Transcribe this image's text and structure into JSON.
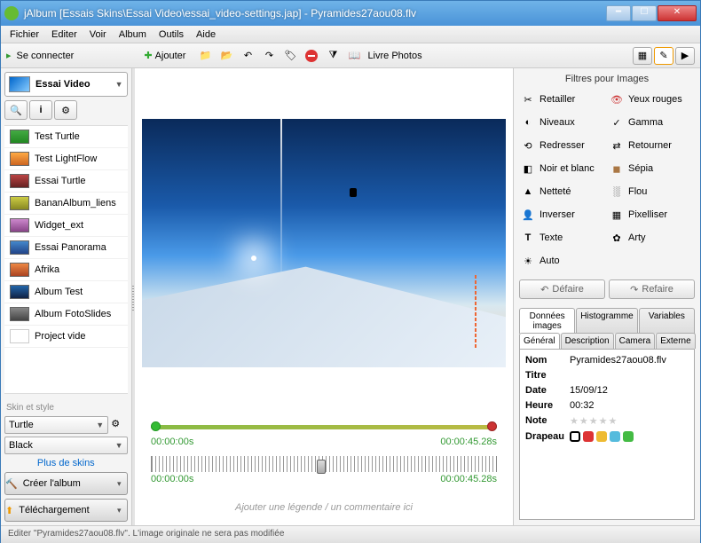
{
  "window": {
    "title": "jAlbum [Essais Skins\\Essai Video\\essai_video-settings.jap] - Pyramides27aou08.flv"
  },
  "menu": {
    "items": [
      "Fichier",
      "Editer",
      "Voir",
      "Album",
      "Outils",
      "Aide"
    ]
  },
  "toolbar": {
    "connect": "Se connecter",
    "add": "Ajouter",
    "livre": "Livre Photos"
  },
  "sidebar": {
    "current": "Essai Video",
    "albums": [
      "Test Turtle",
      "Test LightFlow",
      "Essai Turtle",
      "BananAlbum_liens",
      "Widget_ext",
      "Essai Panorama",
      "Afrika",
      "Album Test",
      "Album FotoSlides",
      "Project vide"
    ],
    "skin_label": "Skin et style",
    "skin": "Turtle",
    "style": "Black",
    "more_skins": "Plus de skins",
    "create": "Créer l'album",
    "download": "Téléchargement"
  },
  "video": {
    "t0": "00:00:00s",
    "t1": "00:00:45.28s",
    "s0": "00:00:00s",
    "s1": "00:00:45.28s",
    "caption_placeholder": "Ajouter une légende / un commentaire ici"
  },
  "filters": {
    "title": "Filtres pour Images",
    "items": [
      "Retailler",
      "Yeux rouges",
      "Niveaux",
      "Gamma",
      "Redresser",
      "Retourner",
      "Noir et blanc",
      "Sépia",
      "Netteté",
      "Flou",
      "Inverser",
      "Pixelliser",
      "Texte",
      "Arty",
      "Auto"
    ],
    "undo": "Défaire",
    "redo": "Refaire"
  },
  "tabs": {
    "row1": [
      "Données images",
      "Histogramme",
      "Variables"
    ],
    "row2": [
      "Général",
      "Description",
      "Camera",
      "Externe"
    ]
  },
  "props": {
    "nom_k": "Nom",
    "nom_v": "Pyramides27aou08.flv",
    "titre_k": "Titre",
    "titre_v": "",
    "date_k": "Date",
    "date_v": "15/09/12",
    "heure_k": "Heure",
    "heure_v": "00:32",
    "note_k": "Note",
    "drapeau_k": "Drapeau"
  },
  "flag_colors": [
    "#000",
    "#d33",
    "#eb3",
    "#5bd",
    "#4b4"
  ],
  "status": "Editer \"Pyramides27aou08.flv\". L'image originale ne sera pas modifiée"
}
